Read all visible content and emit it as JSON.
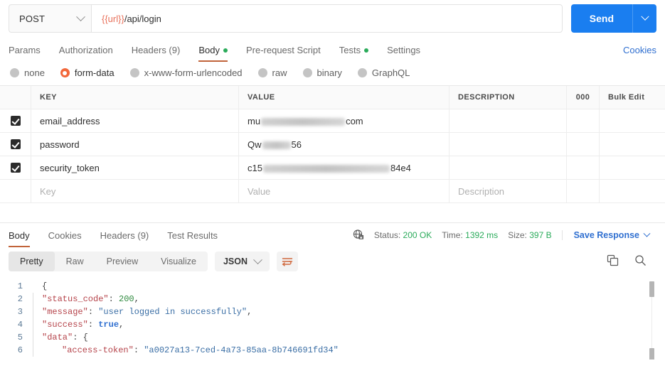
{
  "request": {
    "method": "POST",
    "url_variable": "{{url}}",
    "url_path": "/api/login",
    "send_label": "Send",
    "cookies_label": "Cookies",
    "tabs": [
      {
        "label": "Params",
        "dot": false,
        "active": false
      },
      {
        "label": "Authorization",
        "dot": false,
        "active": false
      },
      {
        "label": "Headers (9)",
        "dot": false,
        "active": false
      },
      {
        "label": "Body",
        "dot": true,
        "active": true
      },
      {
        "label": "Pre-request Script",
        "dot": false,
        "active": false
      },
      {
        "label": "Tests",
        "dot": true,
        "active": false
      },
      {
        "label": "Settings",
        "dot": false,
        "active": false
      }
    ],
    "body_types": [
      {
        "label": "none",
        "selected": false
      },
      {
        "label": "form-data",
        "selected": true
      },
      {
        "label": "x-www-form-urlencoded",
        "selected": false
      },
      {
        "label": "raw",
        "selected": false
      },
      {
        "label": "binary",
        "selected": false
      },
      {
        "label": "GraphQL",
        "selected": false
      }
    ],
    "table": {
      "headers": {
        "key": "KEY",
        "value": "VALUE",
        "description": "DESCRIPTION",
        "dots": "000",
        "bulk_edit": "Bulk Edit"
      },
      "rows": [
        {
          "checked": true,
          "key": "email_address",
          "value_prefix": "mu",
          "value_suffix": "com",
          "redact_width": 118,
          "description": ""
        },
        {
          "checked": true,
          "key": "password",
          "value_prefix": "Qw",
          "value_suffix": "56",
          "redact_width": 40,
          "description": ""
        },
        {
          "checked": true,
          "key": "security_token",
          "value_prefix": "c15",
          "value_suffix": "84e4",
          "redact_width": 178,
          "description": ""
        }
      ],
      "placeholder_row": {
        "key": "Key",
        "value": "Value",
        "description": "Description"
      }
    }
  },
  "response": {
    "tabs": [
      {
        "label": "Body",
        "active": true
      },
      {
        "label": "Cookies",
        "active": false
      },
      {
        "label": "Headers (9)",
        "active": false
      },
      {
        "label": "Test Results",
        "active": false
      }
    ],
    "status_label": "Status:",
    "status_value": "200 OK",
    "time_label": "Time:",
    "time_value": "1392 ms",
    "size_label": "Size:",
    "size_value": "397 B",
    "save_response_label": "Save Response",
    "view_modes": [
      {
        "label": "Pretty",
        "active": true
      },
      {
        "label": "Raw",
        "active": false
      },
      {
        "label": "Preview",
        "active": false
      },
      {
        "label": "Visualize",
        "active": false
      }
    ],
    "format": "JSON",
    "body_lines": [
      {
        "n": "1",
        "indent": 0,
        "segments": [
          {
            "t": "p",
            "v": "{"
          }
        ]
      },
      {
        "n": "2",
        "indent": 1,
        "segments": [
          {
            "t": "key",
            "v": "\"status_code\""
          },
          {
            "t": "p",
            "v": ": "
          },
          {
            "t": "num",
            "v": "200"
          },
          {
            "t": "p",
            "v": ","
          }
        ]
      },
      {
        "n": "3",
        "indent": 1,
        "segments": [
          {
            "t": "key",
            "v": "\"message\""
          },
          {
            "t": "p",
            "v": ": "
          },
          {
            "t": "str",
            "v": "\"user logged in successfully\""
          },
          {
            "t": "p",
            "v": ","
          }
        ]
      },
      {
        "n": "4",
        "indent": 1,
        "segments": [
          {
            "t": "key",
            "v": "\"success\""
          },
          {
            "t": "p",
            "v": ": "
          },
          {
            "t": "bool",
            "v": "true"
          },
          {
            "t": "p",
            "v": ","
          }
        ]
      },
      {
        "n": "5",
        "indent": 1,
        "segments": [
          {
            "t": "key",
            "v": "\"data\""
          },
          {
            "t": "p",
            "v": ": {"
          }
        ]
      },
      {
        "n": "6",
        "indent": 2,
        "segments": [
          {
            "t": "key",
            "v": "\"access-token\""
          },
          {
            "t": "p",
            "v": ": "
          },
          {
            "t": "str",
            "v": "\"a0027a13-7ced-4a73-85aa-8b746691fd34\""
          }
        ]
      }
    ]
  },
  "colors": {
    "send_blue": "#1a7ef0",
    "accent_orange": "#c1633a",
    "radio_orange": "#f2673a",
    "status_green": "#2aab5a",
    "link_blue": "#2f6fd0",
    "var_red": "#e8705a"
  }
}
